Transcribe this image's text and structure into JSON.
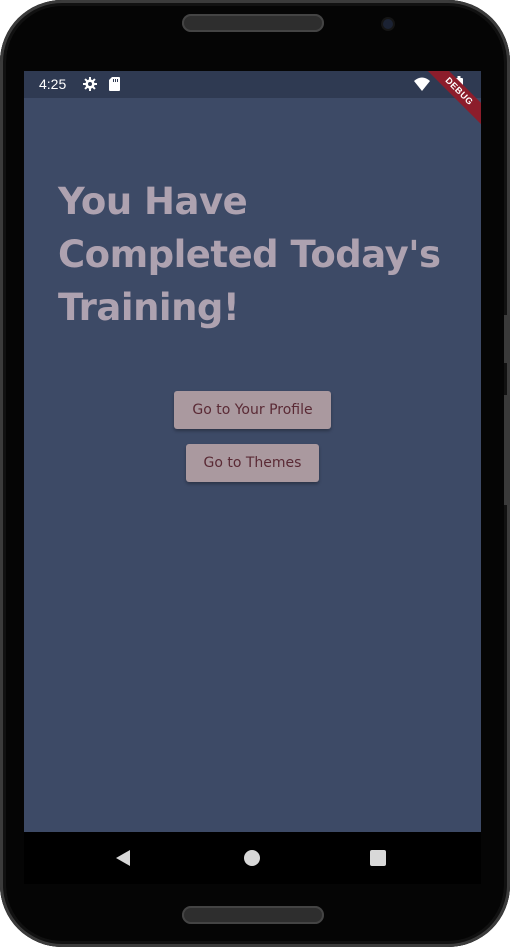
{
  "status_bar": {
    "time": "4:25",
    "icons": [
      "gear-icon",
      "sd-card-icon",
      "wifi-icon",
      "battery-icon"
    ],
    "background": "#2f3a52"
  },
  "debug_banner": {
    "label": "DEBUG",
    "color": "#8c1d2b"
  },
  "main": {
    "title": "You Have Completed Today's Training!",
    "background": "#3d4a66",
    "title_color": "#aea2b0",
    "buttons": [
      {
        "label": "Go to Your Profile"
      },
      {
        "label": "Go to Themes"
      }
    ],
    "button_color": "#aa999f",
    "button_text_color": "#5a2a35"
  },
  "nav_bar": {
    "icons": [
      "back-icon",
      "home-icon",
      "recents-icon"
    ]
  }
}
